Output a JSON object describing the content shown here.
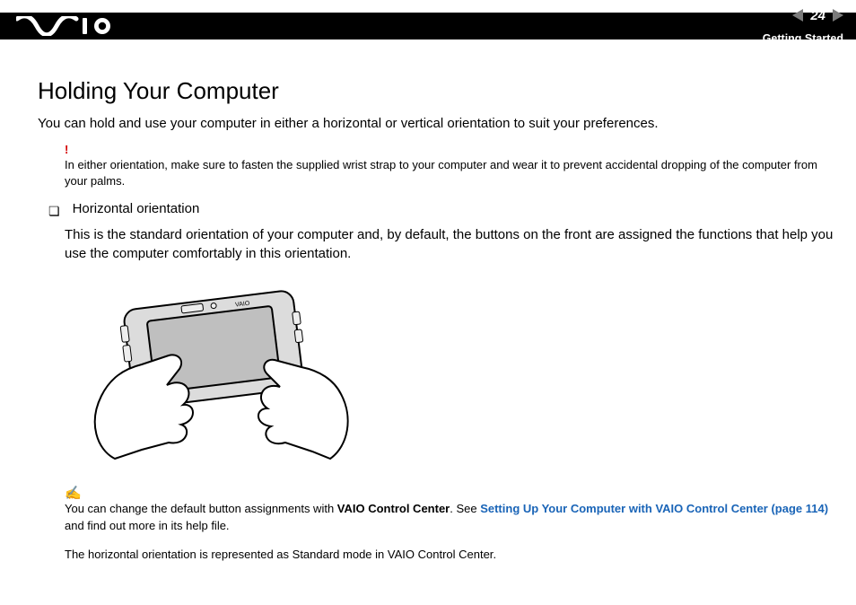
{
  "header": {
    "page_number": "24",
    "section": "Getting Started",
    "brand": "VAIO"
  },
  "title": "Holding Your Computer",
  "lead": "You can hold and use your computer in either a horizontal or vertical orientation to suit your preferences.",
  "warning": {
    "mark": "!",
    "text": "In either orientation, make sure to fasten the supplied wrist strap to your computer and wear it to prevent accidental dropping of the computer from your palms."
  },
  "bullet": {
    "glyph": "❏",
    "label": "Horizontal orientation",
    "body": "This is the standard orientation of your computer and, by default, the buttons on the front are assigned the functions that help you use the computer comfortably in this orientation."
  },
  "note": {
    "mark": "✍",
    "pre": "You can change the default button assignments with ",
    "bold1": "VAIO Control Center",
    "mid1": ". See ",
    "link_text": "Setting Up Your Computer with VAIO Control Center (page 114)",
    "mid2": " and find out more in its help file."
  },
  "after_note": {
    "pre": "The horizontal orientation is represented as Standard mode in ",
    "bold": "VAIO Control Center",
    "post": "."
  },
  "illustration_alt": "Two hands holding a small VAIO ultra-mobile PC in horizontal (landscape) orientation with a wrist strap attached."
}
